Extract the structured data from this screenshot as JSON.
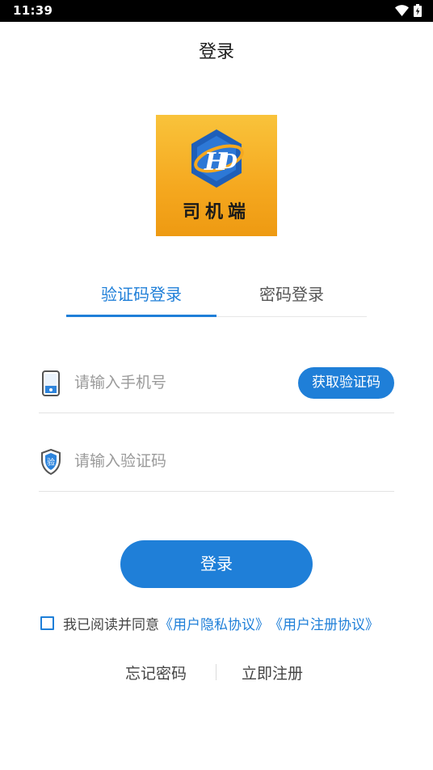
{
  "status_bar": {
    "time": "11:39",
    "wifi_icon": "wifi-icon",
    "battery_icon": "battery-charging-icon"
  },
  "header": {
    "title": "登录"
  },
  "logo": {
    "caption": "司机端",
    "mark_letters": "HD",
    "colors": {
      "bg_top": "#f9c33b",
      "bg_bottom": "#ee9a12",
      "hex": "#1f5fb8"
    }
  },
  "tabs": [
    {
      "label": "验证码登录",
      "active": true
    },
    {
      "label": "密码登录",
      "active": false
    }
  ],
  "form": {
    "phone": {
      "placeholder": "请输入手机号",
      "value": "",
      "icon": "phone-icon"
    },
    "code": {
      "placeholder": "请输入验证码",
      "value": "",
      "icon": "shield-verify-icon",
      "icon_text": "验"
    },
    "get_code_label": "获取验证码",
    "login_label": "登录"
  },
  "agreement": {
    "checked": false,
    "text": "我已阅读并同意",
    "privacy_link": "《用户隐私协议》",
    "register_link": "《用户注册协议》"
  },
  "bottom": {
    "forgot_label": "忘记密码",
    "register_label": "立即注册"
  },
  "colors": {
    "accent": "#1f7fd8",
    "divider": "#e3e3e3"
  }
}
